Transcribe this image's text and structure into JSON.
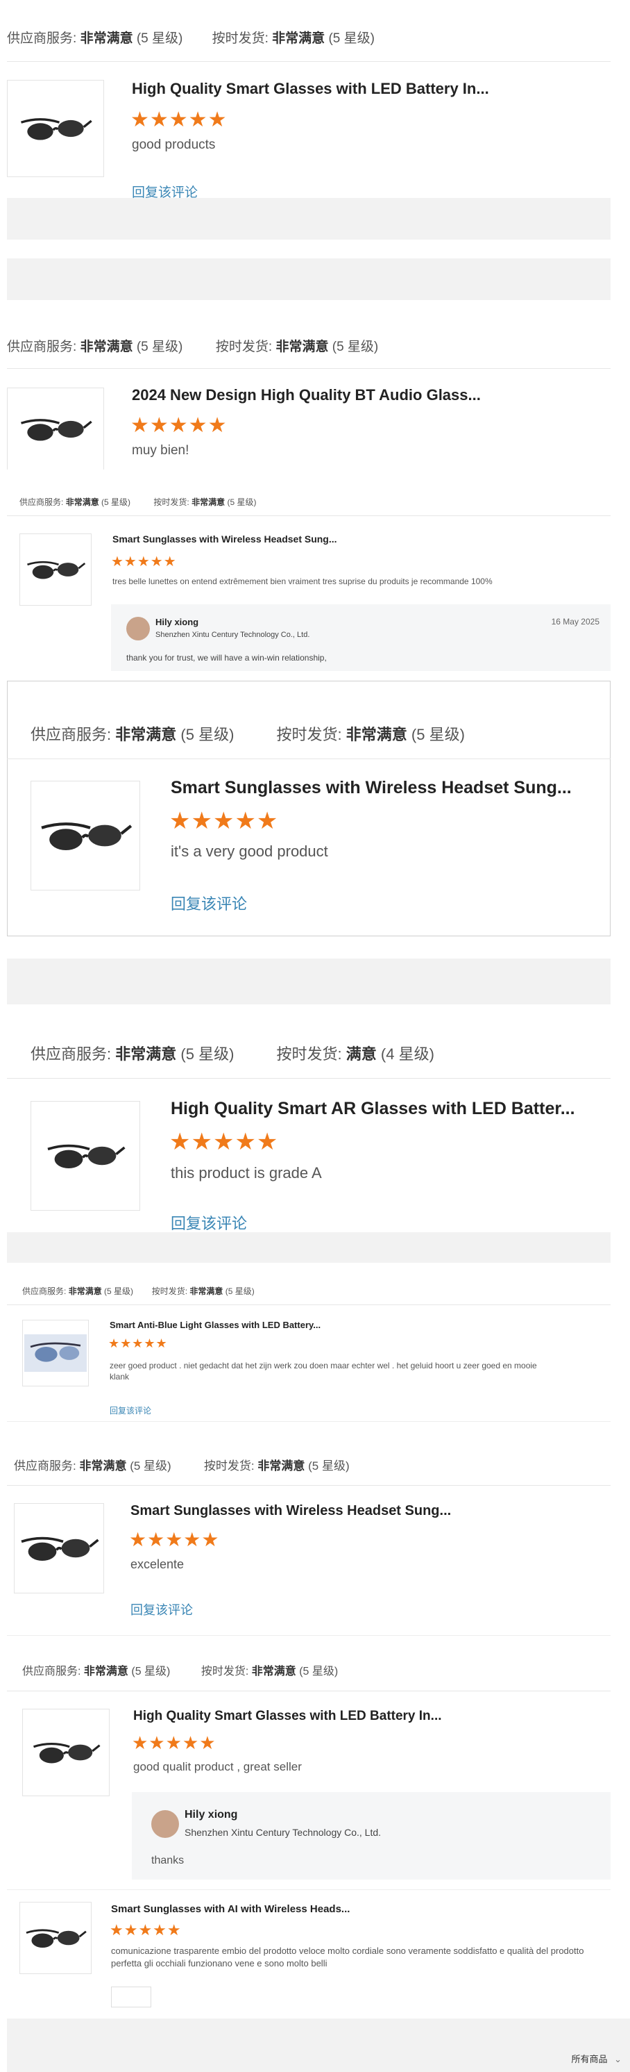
{
  "labels": {
    "supplier_service": "供应商服务:",
    "on_time_shipping": "按时发货:",
    "very_satisfied": "非常满意",
    "satisfied": "满意",
    "five_star": "(5 星级)",
    "four_star": "(4 星级)",
    "reply_review": "回复该评论",
    "stars_five": "★★★★★"
  },
  "reviews": [
    {
      "title": "High Quality Smart Glasses with LED Battery In...",
      "comment": "good products"
    },
    {
      "title": "2024 New Design High Quality BT Audio Glass...",
      "comment": "muy bien!"
    },
    {
      "title": "Smart Sunglasses with Wireless Headset Sung...",
      "comment": "tres belle lunettes on entend extrêmement bien vraiment tres suprise du produits je recommande 100%",
      "seller": {
        "name": "Hily xiong",
        "company": "Shenzhen Xintu Century Technology Co., Ltd.",
        "date": "16 May 2025",
        "reply": "thank you for trust, we will have a win-win relationship,"
      }
    },
    {
      "title": "Smart Sunglasses with Wireless Headset Sung...",
      "comment": "it's a very good product"
    },
    {
      "title": "High Quality Smart AR Glasses with LED Batter...",
      "comment": "this product is grade A"
    },
    {
      "title": "Smart Anti-Blue Light Glasses with LED Battery...",
      "comment": "zeer goed product . niet gedacht dat het zijn werk zou doen maar echter wel . het geluid hoort u zeer goed en mooie klank"
    },
    {
      "title": "Smart Sunglasses with Wireless Headset Sung...",
      "comment": "excelente"
    },
    {
      "title": "High Quality Smart Glasses with LED Battery In...",
      "comment": "good qualit product , great seller",
      "seller": {
        "name": "Hily xiong",
        "company": "Shenzhen Xintu Century Technology Co., Ltd.",
        "reply": "thanks"
      }
    },
    {
      "title": "Smart Sunglasses with AI with Wireless Heads...",
      "comment": "comunicazione trasparente embio del prodotto veloce molto cordiale sono veramente soddisfatto e qualità del prodotto perfetta gli occhiali funzionano vene e sono molto belli"
    }
  ],
  "footer": {
    "all_products": "所有商品"
  }
}
